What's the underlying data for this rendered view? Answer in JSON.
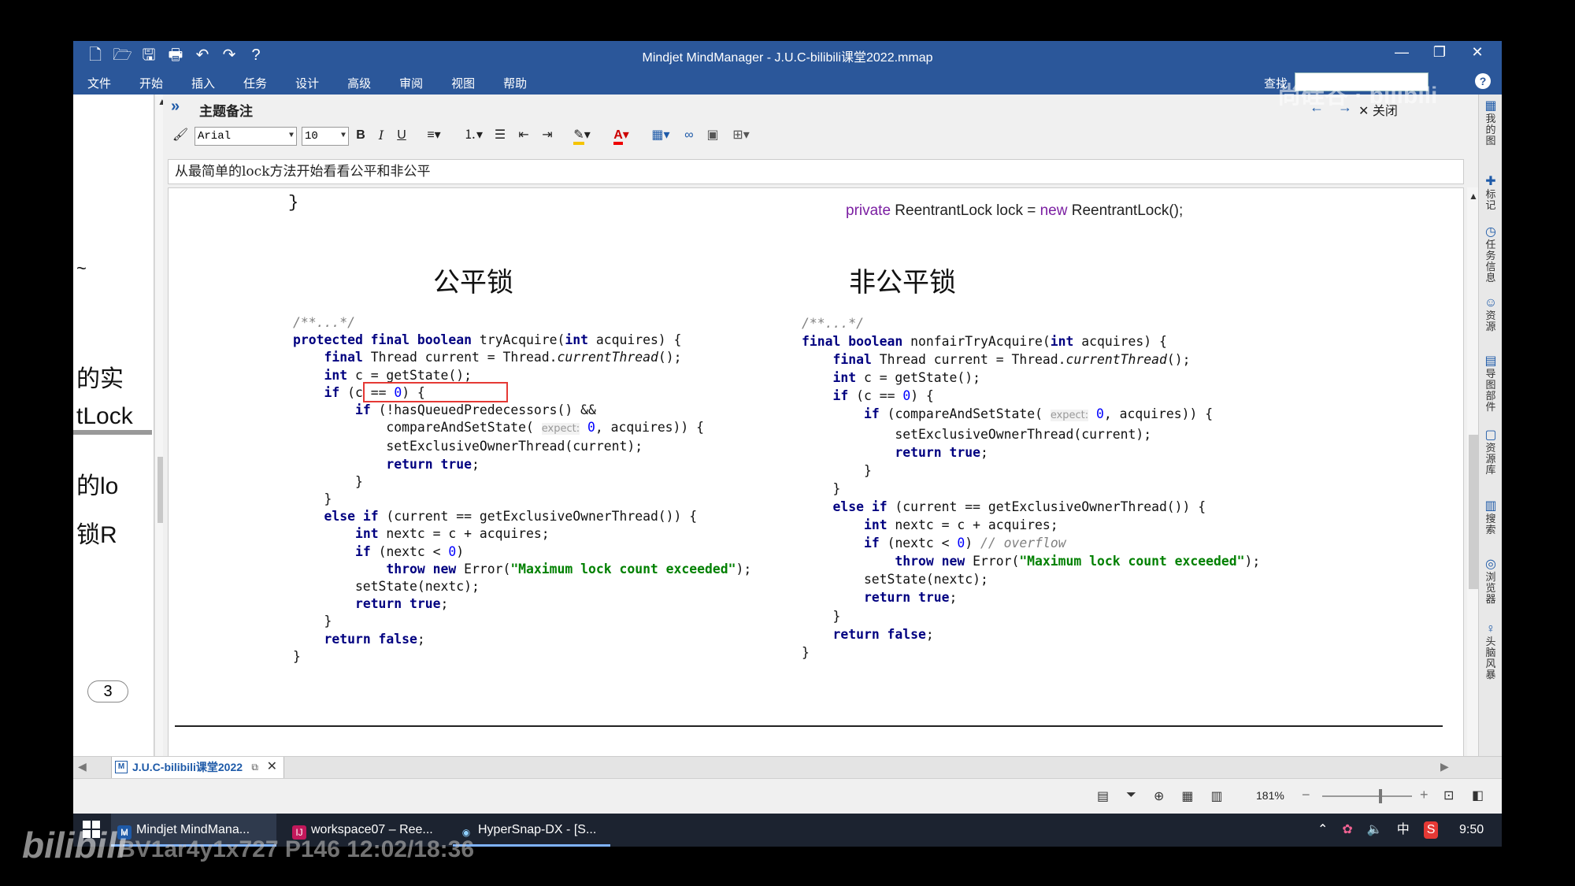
{
  "window": {
    "title": "Mindjet MindManager - J.U.C-bilibili课堂2022.mmap",
    "buttons": [
      "—",
      "❐",
      "✕"
    ]
  },
  "quick_access": [
    "🗋",
    "🗁",
    "🖫",
    "🖶",
    "↶",
    "↷",
    "?"
  ],
  "menu": {
    "items": [
      "文件",
      "开始",
      "插入",
      "任务",
      "设计",
      "高级",
      "审阅",
      "视图",
      "帮助"
    ],
    "search_label": "查找",
    "help": "?"
  },
  "notes_panel": {
    "chevron": "»",
    "label": "主题备注",
    "close_label": "关闭",
    "font": "Arial",
    "size": "10",
    "bold": "B",
    "italic": "I",
    "underline": "U",
    "topic_text": "从最简单的lock方法开始看看公平和非公平"
  },
  "canvas": {
    "brace": "}",
    "field_decl": {
      "private": "private",
      "mid": " ReentrantLock lock = ",
      "new": "new",
      "end": " ReentrantLock();"
    },
    "fair_heading": "公平锁",
    "unfair_heading": "非公平锁"
  },
  "left_outline": {
    "fragments": [
      "~",
      "的实",
      "tLock",
      "的lo",
      "锁R"
    ],
    "badge": "3"
  },
  "right_sidebar": [
    {
      "icon": "▦",
      "label": "我的图"
    },
    {
      "icon": "✚",
      "label": "标记"
    },
    {
      "icon": "◷",
      "label": "任务信息"
    },
    {
      "icon": "☺",
      "label": "资源"
    },
    {
      "icon": "▤",
      "label": "导图部件"
    },
    {
      "icon": "▢",
      "label": "资源库"
    },
    {
      "icon": "▥",
      "label": "搜索"
    },
    {
      "icon": "◎",
      "label": "浏览器"
    },
    {
      "icon": "♀",
      "label": "头脑风暴"
    }
  ],
  "doc_tab": {
    "label": "J.U.C-bilibili课堂2022"
  },
  "status": {
    "zoom": "181%"
  },
  "taskbar": {
    "apps": [
      {
        "icon": "M",
        "label": "Mindjet MindMana..."
      },
      {
        "icon": "IJ",
        "label": "workspace07 – Ree..."
      },
      {
        "icon": "◉",
        "label": "HyperSnap-DX - [S..."
      }
    ],
    "tray": [
      "⌃",
      "✿",
      "🔈",
      "中",
      "S"
    ],
    "time": "9:50"
  },
  "watermarks": {
    "top": "尚硅谷 · bilibili",
    "bottom_logo": "bilibili",
    "bottom_text": "BV1ar4y1x727 P146 12:02/18:36"
  }
}
